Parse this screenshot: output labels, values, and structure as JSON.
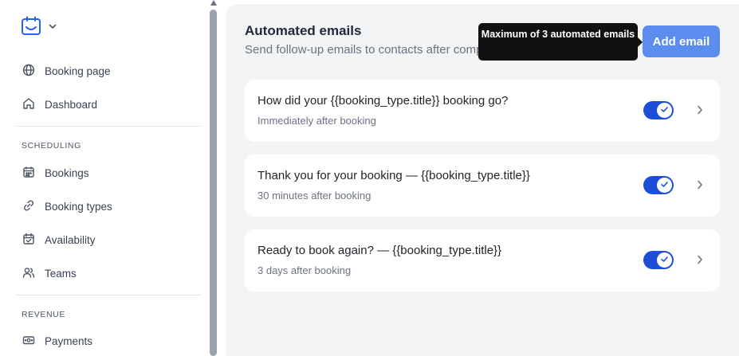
{
  "sidebar": {
    "logo_icon": "calendar-logo-icon",
    "items_top": [
      {
        "label": "Booking page",
        "icon": "globe-icon"
      },
      {
        "label": "Dashboard",
        "icon": "home-icon"
      }
    ],
    "sections": [
      {
        "title": "SCHEDULING",
        "items": [
          {
            "label": "Bookings",
            "icon": "calendar-icon"
          },
          {
            "label": "Booking types",
            "icon": "link-icon"
          },
          {
            "label": "Availability",
            "icon": "calendar-check-icon"
          },
          {
            "label": "Teams",
            "icon": "users-icon"
          }
        ]
      },
      {
        "title": "REVENUE",
        "items": [
          {
            "label": "Payments",
            "icon": "money-icon"
          }
        ]
      }
    ]
  },
  "main": {
    "title": "Automated emails",
    "subtitle": "Send follow-up emails to contacts after completed bookings.",
    "add_button": "Add email",
    "tooltip": "Maximum of 3 automated emails",
    "emails": [
      {
        "title": "How did your {{booking_type.title}} booking go?",
        "timing": "Immediately after booking",
        "enabled": true
      },
      {
        "title": "Thank you for your booking — {{booking_type.title}}",
        "timing": "30 minutes after booking",
        "enabled": true
      },
      {
        "title": "Ready to book again? — {{booking_type.title}}",
        "timing": "3 days after booking",
        "enabled": true
      }
    ]
  },
  "colors": {
    "accent": "#1d4ed8",
    "button": "#5b8def",
    "panel_bg": "#f3f4f6",
    "tooltip_bg": "#111111"
  }
}
